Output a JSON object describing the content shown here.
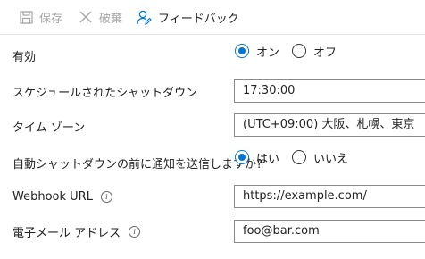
{
  "toolbar": {
    "save_label": "保存",
    "discard_label": "破棄",
    "feedback_label": "フィードバック"
  },
  "form": {
    "enabled": {
      "label": "有効",
      "options": [
        "オン",
        "オフ"
      ],
      "selected": "オン"
    },
    "scheduled_shutdown": {
      "label": "スケジュールされたシャットダウン",
      "value": "17:30:00"
    },
    "timezone": {
      "label": "タイム ゾーン",
      "value": "(UTC+09:00) 大阪、札幌、東京"
    },
    "notify_before_shutdown": {
      "label": "自動シャットダウンの前に通知を送信しますか?",
      "options": [
        "はい",
        "いいえ"
      ],
      "selected": "はい"
    },
    "webhook_url": {
      "label": "Webhook URL",
      "value": "https://example.com/"
    },
    "email_address": {
      "label": "電子メール アドレス",
      "value": "foo@bar.com"
    }
  },
  "colors": {
    "accent": "#0078d4",
    "disabled_text": "#a6a6a6",
    "border": "#8a8a8a"
  },
  "icons": {
    "save": "save-icon",
    "discard": "close-icon",
    "feedback": "feedback-person-icon",
    "info": "info-icon"
  }
}
